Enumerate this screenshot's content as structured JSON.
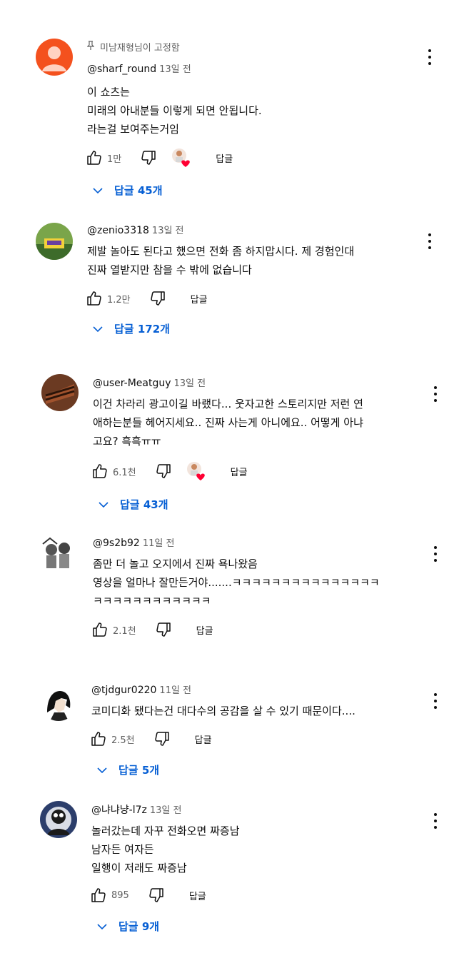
{
  "comments": [
    {
      "pinned_label": "미남재형님이 고정함",
      "handle": "@sharf_round",
      "time": "13일 전",
      "lines": [
        "이 쇼츠는",
        "미래의 아내분들 이렇게 되면 안됩니다.",
        "라는걸 보여주는거임"
      ],
      "likes": "1만",
      "reply_label": "답글",
      "replies_label": "답글 45개"
    },
    {
      "handle": "@zenio3318",
      "time": "13일 전",
      "lines": [
        "제발 놀아도 된다고 했으면 전화 좀 하지맙시다. 제 경험인대",
        "진짜 열받지만 참을 수 밖에 없습니다"
      ],
      "likes": "1.2만",
      "reply_label": "답글",
      "replies_label": "답글 172개"
    },
    {
      "handle": "@user-Meatguy",
      "time": "13일 전",
      "lines": [
        "이건 차라리 광고이길 바랬다... 웃자고한 스토리지만 저런 연",
        "애하는분들 헤어지세요.. 진짜 사는게 아니에요..  어떻게 아냐",
        "고요? 흑흑ㅠㅠ"
      ],
      "likes": "6.1천",
      "reply_label": "답글",
      "replies_label": "답글 43개"
    },
    {
      "handle": "@9s2b92",
      "time": "11일 전",
      "lines": [
        "좀만 더 놀고 오지에서 진짜 욕나왔음",
        "영상을 얼마나 잘만든거야.......ㅋㅋㅋㅋㅋㅋㅋㅋㅋㅋㅋㅋㅋㅋㅋ",
        "ㅋㅋㅋㅋㅋㅋㅋㅋㅋㅋㅋㅋ"
      ],
      "likes": "2.1천",
      "reply_label": "답글"
    },
    {
      "handle": "@tjdgur0220",
      "time": "11일 전",
      "lines": [
        "코미디화 됐다는건 대다수의 공감을 살 수 있기 때문이다...."
      ],
      "likes": "2.5천",
      "reply_label": "답글",
      "replies_label": "답글 5개"
    },
    {
      "handle": "@냐냐냥-l7z",
      "time": "13일 전",
      "lines": [
        "놀러갔는데 자꾸 전화오면 짜증남",
        "남자든 여자든",
        "일행이 저래도 짜증남"
      ],
      "likes": "895",
      "reply_label": "답글",
      "replies_label": "답글 9개"
    }
  ],
  "icons": {
    "pin": "pin-icon",
    "like": "thumbs-up-icon",
    "dislike": "thumbs-down-icon",
    "more": "more-vertical-icon",
    "expand": "chevron-down-icon",
    "heart": "creator-heart-icon"
  },
  "colors": {
    "accent": "#065fd4",
    "secondary_text": "#606060",
    "heart": "#ff0033",
    "avatar_1": "#f4511e"
  }
}
